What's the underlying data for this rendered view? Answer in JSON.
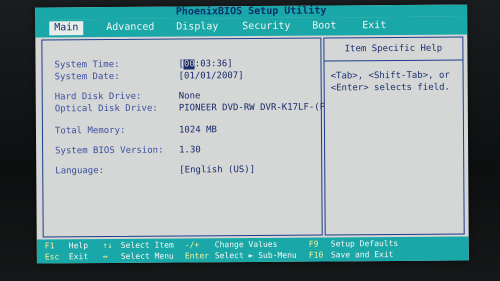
{
  "title": "PhoenixBIOS Setup Utility",
  "menu": [
    {
      "label": "Main",
      "active": true
    },
    {
      "label": "Advanced",
      "active": false
    },
    {
      "label": "Display",
      "active": false
    },
    {
      "label": "Security",
      "active": false
    },
    {
      "label": "Boot",
      "active": false
    },
    {
      "label": "Exit",
      "active": false
    }
  ],
  "fields": {
    "system_time": {
      "label": "System Time:",
      "value_cursor": "00",
      "value_rest": ":03:36]",
      "value_prefix": "["
    },
    "system_date": {
      "label": "System Date:",
      "value": "[01/01/2007]"
    },
    "hard_disk": {
      "label": "Hard Disk Drive:",
      "value": "None"
    },
    "optical": {
      "label": "Optical Disk Drive:",
      "value": "PIONEER DVD-RW DVR-K17LF-(P"
    },
    "memory": {
      "label": "Total Memory:",
      "value": "1024 MB"
    },
    "bios_version": {
      "label": "System BIOS Version:",
      "value": "1.30"
    },
    "language": {
      "label": "Language:",
      "value": "[English  (US)]"
    }
  },
  "help": {
    "title": "Item Specific Help",
    "text": "<Tab>, <Shift-Tab>, or <Enter> selects field."
  },
  "status": {
    "row1": [
      {
        "key": "F1",
        "action": "Help"
      },
      {
        "key": "↑↓",
        "action": "Select Item"
      },
      {
        "key": "-/+",
        "action": "Change Values"
      },
      {
        "key": "F9",
        "action": "Setup Defaults"
      }
    ],
    "row2": [
      {
        "key": "Esc",
        "action": "Exit"
      },
      {
        "key": "↔",
        "action": "Select Menu"
      },
      {
        "key": "Enter",
        "action": "Select ► Sub-Menu"
      },
      {
        "key": "F10",
        "action": "Save and Exit"
      }
    ]
  }
}
